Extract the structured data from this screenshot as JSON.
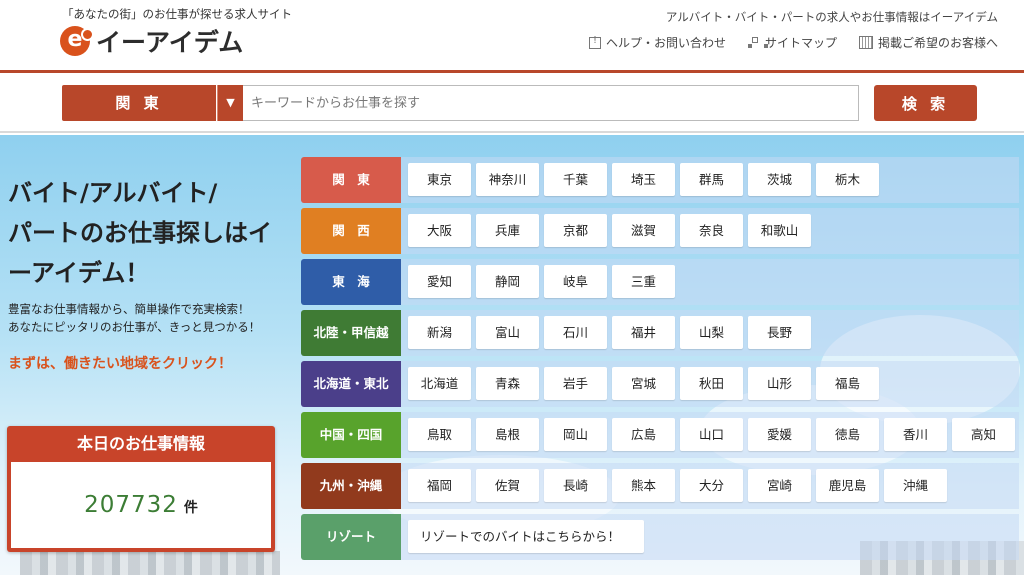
{
  "header": {
    "tagline": "「あなたの街」のお仕事が探せる求人サイト",
    "logo_mark": "e",
    "logo_text": "イーアイデム",
    "right_text": "アルバイト・バイト・パートの求人やお仕事情報はイーアイデム",
    "links": [
      {
        "label": "ヘルプ・お問い合わせ",
        "icon": "help-icon"
      },
      {
        "label": "サイトマップ",
        "icon": "sitemap-icon"
      },
      {
        "label": "掲載ご希望のお客様へ",
        "icon": "building-icon"
      }
    ]
  },
  "search": {
    "region": "関 東",
    "caret": "▼",
    "placeholder": "キーワードからお仕事を探す",
    "value": "",
    "button_label": "検 索"
  },
  "hero": {
    "title_line1": "バイト/アルバイト/",
    "title_line2": "パートのお仕事探しはイ",
    "title_line3": "ーアイデム！",
    "desc_line1": "豊富なお仕事情報から、簡単操作で充実検索！",
    "desc_line2": "あなたにピッタリのお仕事が、きっと見つかる！",
    "cta": "まずは、働きたい地域をクリック！"
  },
  "jobs": {
    "title": "本日のお仕事情報",
    "count": "207732",
    "unit": "件"
  },
  "colors": {
    "brand": "#b8472a",
    "kanto": "#d75b4b",
    "kansai": "#e07f22",
    "tokai": "#2f5da8",
    "hokuriku": "#3f7b34",
    "hokkaido": "#4b3f8a",
    "chugoku": "#58a32c",
    "kyushu": "#913a1d",
    "resort": "#5aa06a"
  },
  "regions": [
    {
      "label": "関　東",
      "color": "#d75b4b",
      "prefs": [
        "東京",
        "神奈川",
        "千葉",
        "埼玉",
        "群馬",
        "茨城",
        "栃木"
      ]
    },
    {
      "label": "関　西",
      "color": "#e07f22",
      "prefs": [
        "大阪",
        "兵庫",
        "京都",
        "滋賀",
        "奈良",
        "和歌山"
      ]
    },
    {
      "label": "東　海",
      "color": "#2f5da8",
      "prefs": [
        "愛知",
        "静岡",
        "岐阜",
        "三重"
      ]
    },
    {
      "label": "北陸・甲信越",
      "color": "#3f7b34",
      "prefs": [
        "新潟",
        "富山",
        "石川",
        "福井",
        "山梨",
        "長野"
      ]
    },
    {
      "label": "北海道・東北",
      "color": "#4b3f8a",
      "prefs": [
        "北海道",
        "青森",
        "岩手",
        "宮城",
        "秋田",
        "山形",
        "福島"
      ]
    },
    {
      "label": "中国・四国",
      "color": "#58a32c",
      "prefs": [
        "鳥取",
        "島根",
        "岡山",
        "広島",
        "山口",
        "愛媛",
        "徳島",
        "香川",
        "高知"
      ]
    },
    {
      "label": "九州・沖縄",
      "color": "#913a1d",
      "prefs": [
        "福岡",
        "佐賀",
        "長崎",
        "熊本",
        "大分",
        "宮崎",
        "鹿児島",
        "沖縄"
      ]
    },
    {
      "label": "リゾート",
      "color": "#5aa06a",
      "prefs": [
        "リゾートでのバイトはこちらから！"
      ]
    }
  ]
}
